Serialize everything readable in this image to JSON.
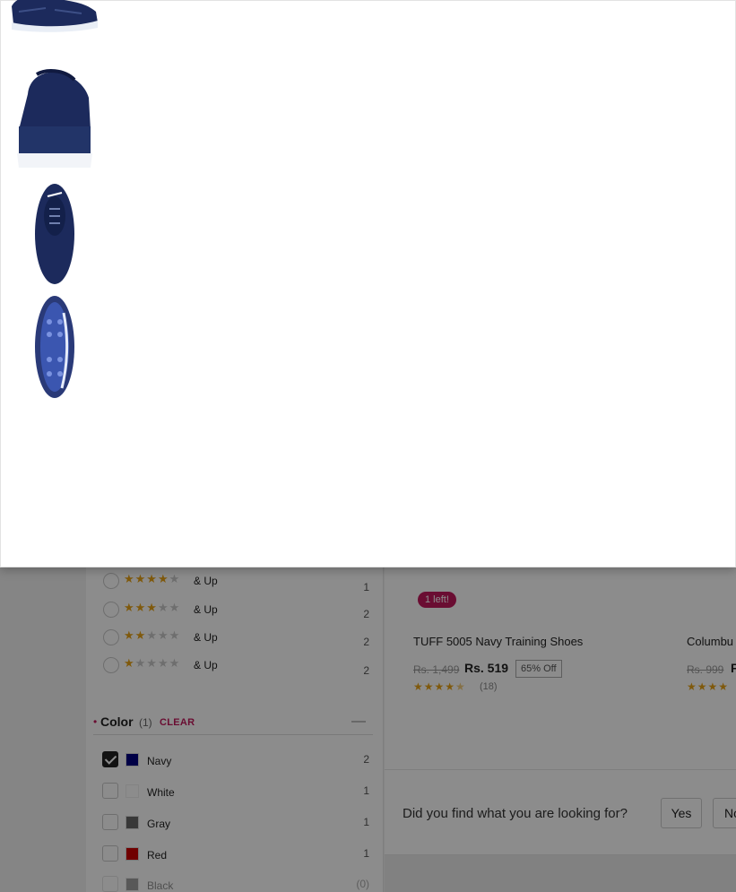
{
  "rating_filter": {
    "rows": [
      {
        "stars": 4,
        "label": "& Up",
        "count": "1"
      },
      {
        "stars": 3,
        "label": "& Up",
        "count": "2"
      },
      {
        "stars": 2,
        "label": "& Up",
        "count": "2"
      },
      {
        "stars": 1,
        "label": "& Up",
        "count": "2"
      }
    ]
  },
  "color_filter": {
    "bullet": "•",
    "title": "Color",
    "selected_count": "(1)",
    "clear_label": "CLEAR",
    "collapse_icon": "—",
    "options": [
      {
        "name": "Navy",
        "count": "2",
        "checked": true,
        "color": "#000080"
      },
      {
        "name": "White",
        "count": "1",
        "checked": false,
        "color": "#ffffff"
      },
      {
        "name": "Gray",
        "count": "1",
        "checked": false,
        "color": "#666666"
      },
      {
        "name": "Red",
        "count": "1",
        "checked": false,
        "color": "#cc0000"
      },
      {
        "name": "Black",
        "count": "(0)",
        "checked": false,
        "color": "#444444"
      }
    ]
  },
  "product": {
    "badge": "1 left!",
    "name": "TUFF 5005 Navy Training Shoes",
    "mrp": "Rs. 1,499",
    "price": "Rs. 519",
    "discount": "65% Off",
    "stars_text": "★★★★★",
    "reviews": "(18)"
  },
  "product2": {
    "name": "Columbu",
    "mrp": "Rs. 999",
    "price": "F",
    "stars_text": "★★★★"
  },
  "feedback": {
    "question": "Did you find what you are looking for?",
    "yes_label": "Yes",
    "no_label": "No"
  },
  "modal": {
    "thumbnails": [
      "shoe-side-view",
      "shoe-back-view",
      "shoe-top-view",
      "shoe-sole-view"
    ]
  },
  "colors": {
    "accent": "#c2185b",
    "star": "#e8a317",
    "shoe_navy": "#1c2a5c"
  }
}
